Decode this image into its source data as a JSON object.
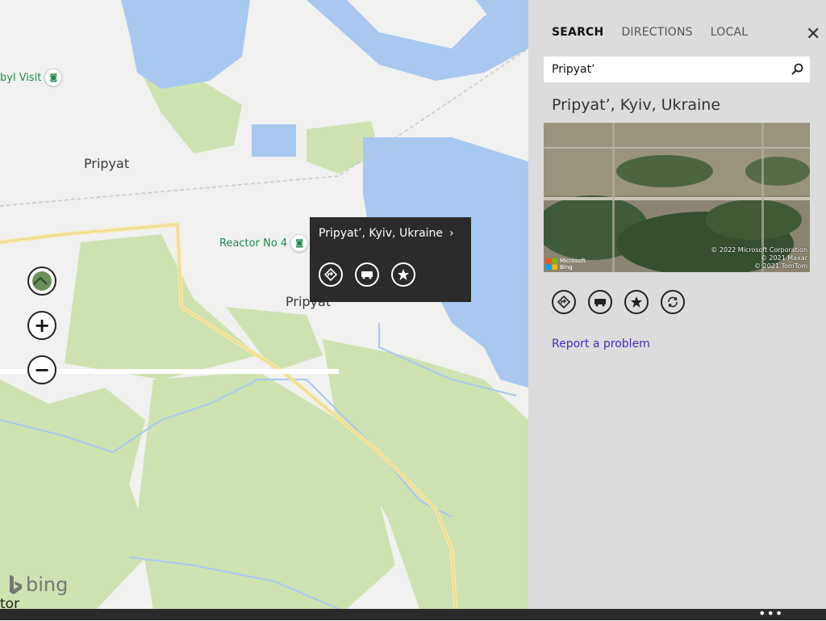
{
  "map": {
    "labels": {
      "pripyat_top": "Pripyat",
      "pripyat_center": "Pripyat",
      "partial_bottom": "tor"
    },
    "pois": {
      "chernobyl_visit": "byl Visit",
      "reactor": "Reactor No 4"
    },
    "controls": {
      "layers": "map-layers",
      "zoom_in": "+",
      "zoom_out": "−"
    },
    "brand": "bing",
    "colors": {
      "water": "#a8c8f0",
      "park": "#cfe2b2",
      "land": "#f1f1ef",
      "road": "#f6e7a6"
    }
  },
  "popup": {
    "title": "Pripyat’, Kyiv, Ukraine",
    "actions": [
      "directions-icon",
      "transit-icon",
      "favorite-icon"
    ]
  },
  "panel": {
    "tabs": [
      {
        "label": "SEARCH",
        "active": true
      },
      {
        "label": "DIRECTIONS",
        "active": false
      },
      {
        "label": "LOCAL",
        "active": false
      }
    ],
    "close_icon": "close-icon",
    "search": {
      "value": "Pripyat’",
      "icon": "search-icon"
    },
    "result_title": "Pripyat’, Kyiv, Ukraine",
    "photo": {
      "credit_lines": [
        "© 2022 Microsoft Corporation",
        "© 2021 Maxar",
        "© 2021 TomTom"
      ],
      "brand_lines": [
        "Microsoft",
        "Bing"
      ]
    },
    "actions": [
      "directions-icon",
      "transit-icon",
      "favorite-icon",
      "refresh-icon"
    ],
    "report_link": "Report a problem"
  },
  "appbar": {
    "more_icon": "•••"
  }
}
